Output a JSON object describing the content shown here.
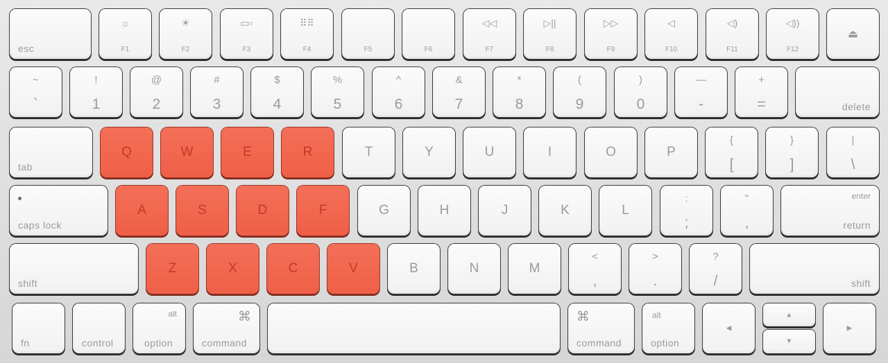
{
  "keyboard": {
    "function_row": [
      {
        "id": "esc",
        "label": "esc"
      },
      {
        "id": "f1",
        "icon": "brightness-low-icon",
        "glyph": "☼",
        "label": "F1"
      },
      {
        "id": "f2",
        "icon": "brightness-high-icon",
        "glyph": "☀",
        "label": "F2"
      },
      {
        "id": "f3",
        "icon": "mission-control-icon",
        "glyph": "▭▫",
        "label": "F3"
      },
      {
        "id": "f4",
        "icon": "launchpad-icon",
        "glyph": "⠿⠿",
        "label": "F4"
      },
      {
        "id": "f5",
        "label": "F5"
      },
      {
        "id": "f6",
        "label": "F6"
      },
      {
        "id": "f7",
        "icon": "rewind-icon",
        "glyph": "◁◁",
        "label": "F7"
      },
      {
        "id": "f8",
        "icon": "play-pause-icon",
        "glyph": "▷||",
        "label": "F8"
      },
      {
        "id": "f9",
        "icon": "fast-forward-icon",
        "glyph": "▷▷",
        "label": "F9"
      },
      {
        "id": "f10",
        "icon": "mute-icon",
        "glyph": "◁",
        "label": "F10"
      },
      {
        "id": "f11",
        "icon": "volume-down-icon",
        "glyph": "◁)",
        "label": "F11"
      },
      {
        "id": "f12",
        "icon": "volume-up-icon",
        "glyph": "◁))",
        "label": "F12"
      },
      {
        "id": "eject",
        "icon": "eject-icon",
        "glyph": "⏏"
      }
    ],
    "number_row": [
      {
        "up": "~",
        "dn": "`"
      },
      {
        "up": "!",
        "dn": "1"
      },
      {
        "up": "@",
        "dn": "2"
      },
      {
        "up": "#",
        "dn": "3"
      },
      {
        "up": "$",
        "dn": "4"
      },
      {
        "up": "%",
        "dn": "5"
      },
      {
        "up": "^",
        "dn": "6"
      },
      {
        "up": "&",
        "dn": "7"
      },
      {
        "up": "*",
        "dn": "8"
      },
      {
        "up": "(",
        "dn": "9"
      },
      {
        "up": ")",
        "dn": "0"
      },
      {
        "up": "—",
        "dn": "-"
      },
      {
        "up": "+",
        "dn": "="
      },
      {
        "label": "delete"
      }
    ],
    "top_row": {
      "tab": "tab",
      "letters": [
        "Q",
        "W",
        "E",
        "R",
        "T",
        "Y",
        "U",
        "I",
        "O",
        "P"
      ],
      "brackets": [
        {
          "up": "{",
          "dn": "["
        },
        {
          "up": "}",
          "dn": "]"
        },
        {
          "up": "|",
          "dn": "\\"
        }
      ]
    },
    "home_row": {
      "caps": "caps lock",
      "letters": [
        "A",
        "S",
        "D",
        "F",
        "G",
        "H",
        "J",
        "K",
        "L"
      ],
      "punct": [
        {
          "up": ":",
          "dn": ";"
        },
        {
          "up": "\"",
          "dn": ","
        }
      ],
      "enter_top": "enter",
      "enter_bottom": "return"
    },
    "bottom_row": {
      "shift_left": "shift",
      "letters": [
        "Z",
        "X",
        "C",
        "V",
        "B",
        "N",
        "M"
      ],
      "punct": [
        {
          "up": "<",
          "dn": ","
        },
        {
          "up": ">",
          "dn": "."
        },
        {
          "up": "?",
          "dn": "/"
        }
      ],
      "shift_right": "shift"
    },
    "modifier_row": {
      "fn": "fn",
      "control": "control",
      "alt": "alt",
      "option": "option",
      "cmd_symbol": "⌘",
      "command": "command",
      "arrow_left": "◀",
      "arrow_up": "▲",
      "arrow_down": "▼",
      "arrow_right": "▶"
    },
    "highlight_color": "#f06a52"
  }
}
